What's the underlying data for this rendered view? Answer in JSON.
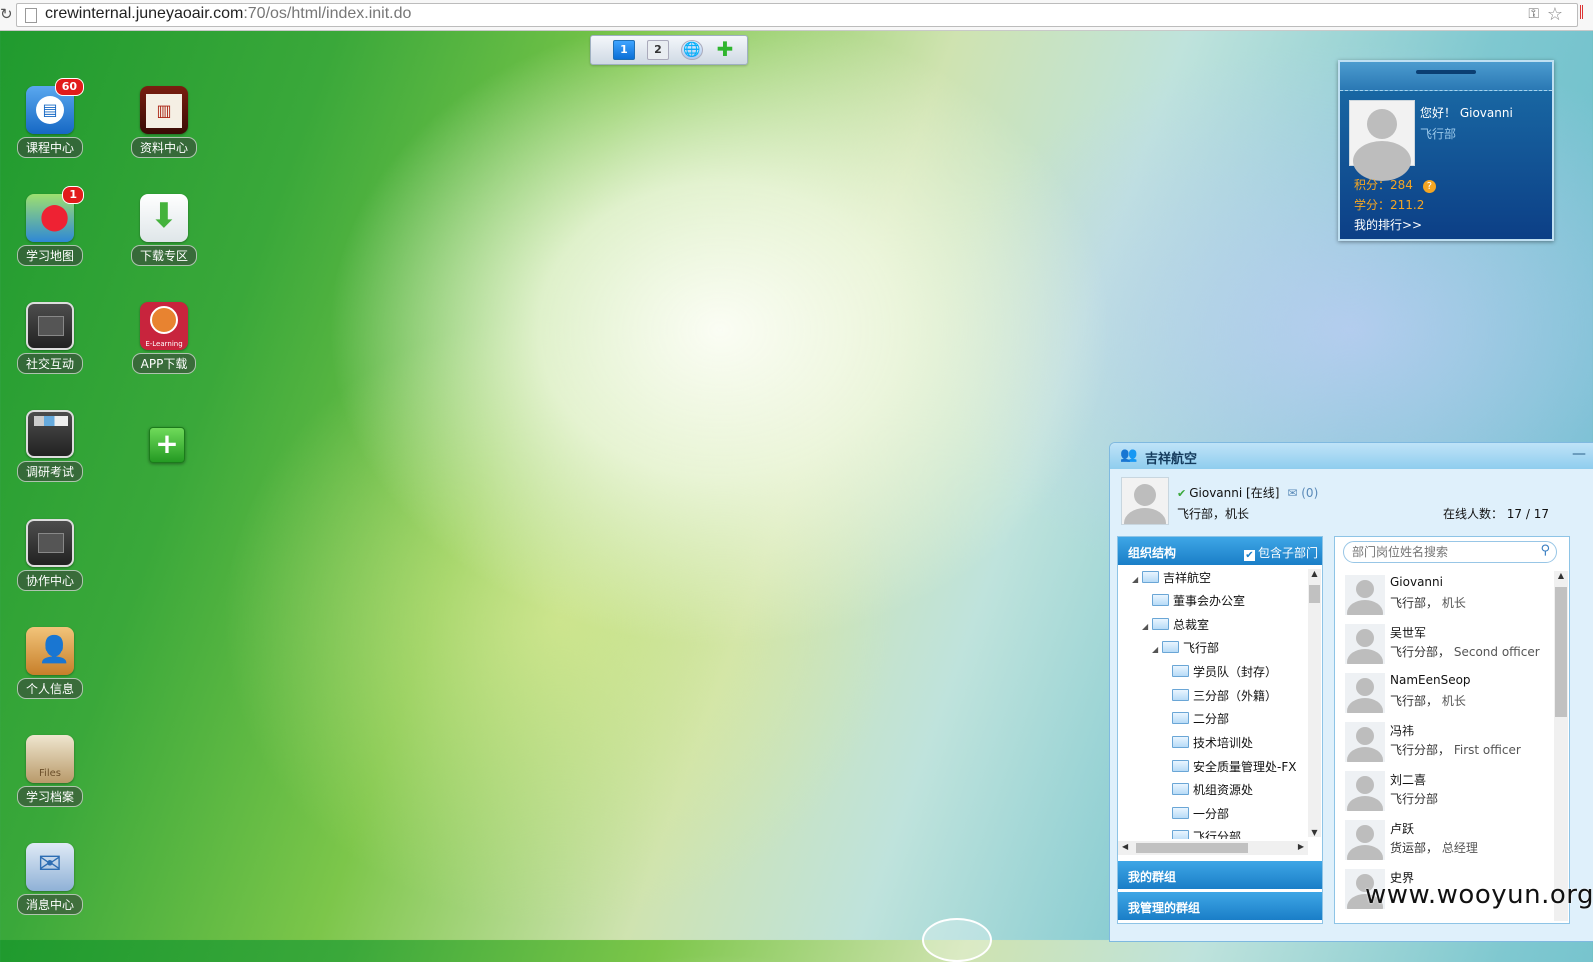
{
  "browser": {
    "url_host": "crewinternal.juneyaoair.com",
    "url_rest": ":70/os/html/index.init.do"
  },
  "desktop_switch": {
    "desk1": "1",
    "desk2": "2"
  },
  "desktop_icons": [
    {
      "label": "课程中心",
      "badge": "60",
      "icon": "book-icon"
    },
    {
      "label": "资料中心",
      "icon": "library-icon"
    },
    {
      "label": "学习地图",
      "badge": "1",
      "icon": "map-icon"
    },
    {
      "label": "下载专区",
      "icon": "download-icon"
    },
    {
      "label": "社交互动",
      "icon": "folder-icon"
    },
    {
      "label": "APP下载",
      "icon": "elearning-app-icon",
      "logo_text": "E-Learning"
    },
    {
      "label": "调研考试",
      "icon": "survey-icon"
    },
    {
      "label": "协作中心",
      "icon": "folder-icon"
    },
    {
      "label": "个人信息",
      "icon": "contact-card-icon"
    },
    {
      "label": "学习档案",
      "icon": "files-icon",
      "logo_text": "Files"
    },
    {
      "label": "消息中心",
      "icon": "mail-icon"
    }
  ],
  "user_card": {
    "greeting": "您好！ Giovanni",
    "dept": "飞行部",
    "points": "积分：284",
    "credits": "学分：211.2",
    "rank_link": "我的排行>>"
  },
  "im": {
    "title": "吉祥航空",
    "me_name": "Giovanni [在线]",
    "mail_count": "(0)",
    "me_role": "飞行部，机长",
    "online_label": "在线人数：",
    "online_value": "17 / 17",
    "org_title": "组织结构",
    "include_sub": "包含子部门",
    "tree": [
      {
        "label": "吉祥航空",
        "depth": 0,
        "expanded": true
      },
      {
        "label": "董事会办公室",
        "depth": 1
      },
      {
        "label": "总裁室",
        "depth": 1,
        "expanded": true
      },
      {
        "label": "飞行部",
        "depth": 2,
        "expanded": true
      },
      {
        "label": "学员队（封存）",
        "depth": 3
      },
      {
        "label": "三分部（外籍）",
        "depth": 3
      },
      {
        "label": "二分部",
        "depth": 3
      },
      {
        "label": "技术培训处",
        "depth": 3
      },
      {
        "label": "安全质量管理处-FX",
        "depth": 3
      },
      {
        "label": "机组资源处",
        "depth": 3
      },
      {
        "label": "一分部",
        "depth": 3
      },
      {
        "label": "飞行分部",
        "depth": 3
      }
    ],
    "my_groups": "我的群组",
    "managed_groups": "我管理的群组",
    "search_placeholder": "部门岗位姓名搜索",
    "contacts": [
      {
        "name": "Giovanni",
        "dept": "飞行部，",
        "role": "机长"
      },
      {
        "name": "吴世军",
        "dept": "飞行分部，",
        "role": "Second officer"
      },
      {
        "name": "NamEenSeop",
        "dept": "飞行部，",
        "role": "机长"
      },
      {
        "name": "冯祎",
        "dept": "飞行分部，",
        "role": "First officer"
      },
      {
        "name": "刘二喜",
        "dept": "飞行分部",
        "role": ""
      },
      {
        "name": "卢跃",
        "dept": "货运部，",
        "role": "总经理"
      },
      {
        "name": "史界",
        "dept": "",
        "role": ""
      }
    ]
  },
  "watermark": "www.wooyun.org"
}
